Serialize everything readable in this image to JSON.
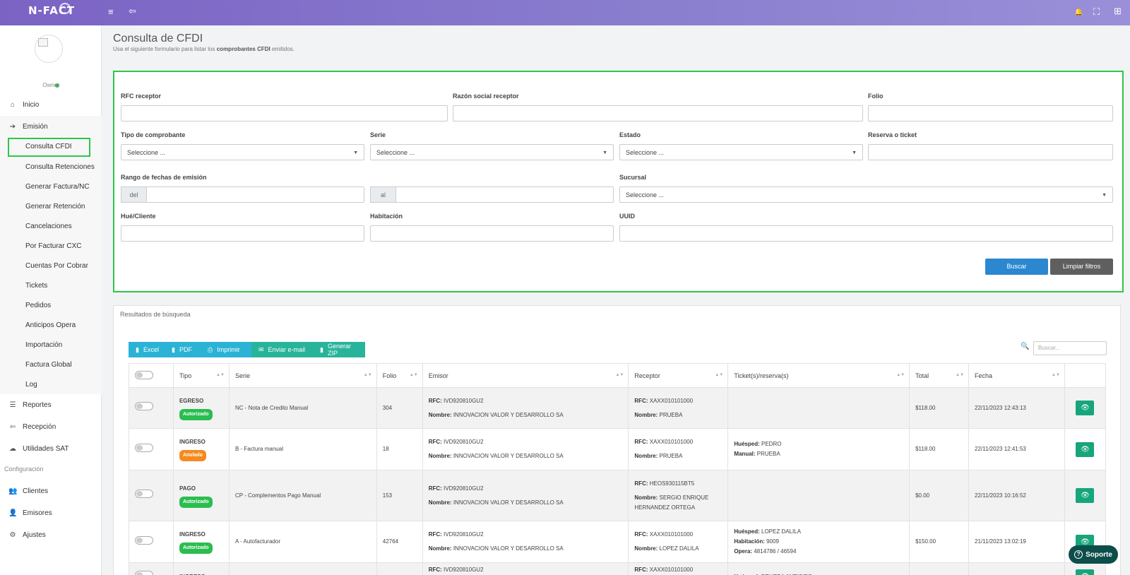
{
  "topbar": {
    "logo": "N-FACT",
    "menu_icon": "≡",
    "logout_icon": "⇦",
    "bell_icon": "🔔",
    "fullscreen_icon": "⛶",
    "apps_icon": "⊞"
  },
  "sidebar": {
    "role": "Owner",
    "items": [
      {
        "label": "Inicio",
        "icon": "⌂"
      },
      {
        "label": "Emisión",
        "icon": "➔"
      }
    ],
    "sub_items": [
      "Consulta CFDI",
      "Consulta Retenciones",
      "Generar Factura/NC",
      "Generar Retención",
      "Cancelaciones",
      "Por Facturar CXC",
      "Cuentas Por Cobrar",
      "Tickets",
      "Pedidos",
      "Anticipos Opera",
      "Importación",
      "Factura Global",
      "Log"
    ],
    "items2": [
      {
        "label": "Reportes",
        "icon": "☰"
      },
      {
        "label": "Recepción",
        "icon": "⇦"
      },
      {
        "label": "Utilidades SAT",
        "icon": "☁"
      }
    ],
    "config_label": "Configuración",
    "config_items": [
      {
        "label": "Clientes",
        "icon": "👥"
      },
      {
        "label": "Emisores",
        "icon": "👤"
      },
      {
        "label": "Ajustes",
        "icon": "⚙"
      }
    ]
  },
  "page": {
    "title": "Consulta de CFDI",
    "subtitle_pre": "Usa el siguiente formulario para listar los ",
    "subtitle_bold": "comprobantes CFDI",
    "subtitle_post": " emitidos."
  },
  "filters": {
    "rfc_label": "RFC receptor",
    "razon_label": "Razón social receptor",
    "folio_label": "Folio",
    "tipo_label": "Tipo de comprobante",
    "serie_label": "Serie",
    "estado_label": "Estado",
    "reserva_label": "Reserva o ticket",
    "rango_label": "Rango de fechas de emisión",
    "sucursal_label": "Sucursal",
    "huesped_label": "Hué/Cliente",
    "habitacion_label": "Habitación",
    "uuid_label": "UUID",
    "select_placeholder": "Seleccione ...",
    "del": "del",
    "al": "al",
    "buscar": "Buscar",
    "limpiar": "Limpiar filtros"
  },
  "results": {
    "title": "Resultados de búsqueda",
    "buttons": [
      "Excel",
      "PDF",
      "Imprimir",
      "Enviar e-mail",
      "Generar ZIP"
    ],
    "search_placeholder": "Buscar...",
    "columns": [
      "Tipo",
      "Serie",
      "Folio",
      "Emisor",
      "Receptor",
      "Ticket(s)/reserva(s)",
      "Total",
      "Fecha"
    ],
    "rows": [
      {
        "tipo": "EGRESO",
        "estado": "Autorizado",
        "estado_color": "#2bbd4f",
        "serie": "NC - Nota de Credito Manual",
        "folio": "304",
        "emisor_rfc": "IVD920810GU2",
        "emisor_nombre": "INNOVACION VALOR Y DESARROLLO SA",
        "receptor_rfc": "XAXX010101000",
        "receptor_nombre": "PRUEBA",
        "tickets": [],
        "total": "$118.00",
        "fecha": "22/11/2023 12:43:13"
      },
      {
        "tipo": "INGRESO",
        "estado": "Anulado",
        "estado_color": "#f58a1f",
        "serie": "B - Factura manual",
        "folio": "18",
        "emisor_rfc": "IVD920810GU2",
        "emisor_nombre": "INNOVACION VALOR Y DESARROLLO SA",
        "receptor_rfc": "XAXX010101000",
        "receptor_nombre": "PRUEBA",
        "tickets": [
          {
            "k": "Huésped:",
            "v": "PEDRO"
          },
          {
            "k": "Manual:",
            "v": "PRUEBA"
          }
        ],
        "total": "$118.00",
        "fecha": "22/11/2023 12:41:53"
      },
      {
        "tipo": "PAGO",
        "estado": "Autorizado",
        "estado_color": "#2bbd4f",
        "serie": "CP - Complementos Pago Manual",
        "folio": "153",
        "emisor_rfc": "IVD920810GU2",
        "emisor_nombre": "INNOVACION VALOR Y DESARROLLO SA",
        "receptor_rfc": "HEOS930115BT5",
        "receptor_nombre": "SERGIO ENRIQUE HERNANDEZ ORTEGA",
        "tickets": [],
        "total": "$0.00",
        "fecha": "22/11/2023 10:16:52"
      },
      {
        "tipo": "INGRESO",
        "estado": "Autorizado",
        "estado_color": "#2bbd4f",
        "serie": "A - Autofacturador",
        "folio": "42764",
        "emisor_rfc": "IVD920810GU2",
        "emisor_nombre": "INNOVACION VALOR Y DESARROLLO SA",
        "receptor_rfc": "XAXX010101000",
        "receptor_nombre": "LOPEZ DALILA",
        "tickets": [
          {
            "k": "Huésped:",
            "v": "LOPEZ DALILA"
          },
          {
            "k": "Habitación:",
            "v": "9009"
          },
          {
            "k": "Opera:",
            "v": "4814786 / 46594"
          }
        ],
        "total": "$150.00",
        "fecha": "21/11/2023 13:02:19"
      },
      {
        "tipo": "INGRESO",
        "estado": "",
        "estado_color": "#2bbd4f",
        "serie": "",
        "folio": "",
        "emisor_rfc": "IVD920810GU2",
        "emisor_nombre": "",
        "receptor_rfc": "XAXX010101000",
        "receptor_nombre": "",
        "tickets": [
          {
            "k": "Huésped:",
            "v": "PRUEBA ANTICIPO"
          }
        ],
        "total": "",
        "fecha": ""
      }
    ],
    "rfc_key": "RFC:",
    "nombre_key": "Nombre:"
  },
  "soporte": "Soporte"
}
